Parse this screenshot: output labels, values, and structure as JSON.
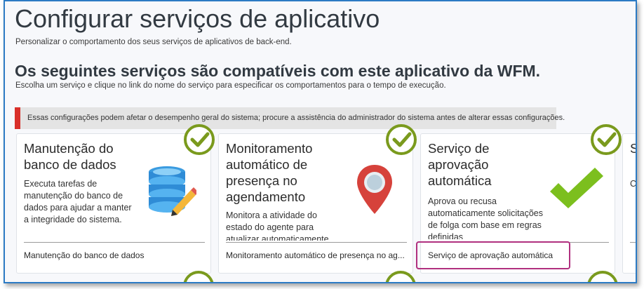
{
  "header": {
    "title": "Configurar serviços de aplicativo",
    "subtitle": "Personalizar o comportamento dos seus serviços de aplicativos de back-end."
  },
  "section": {
    "title": "Os seguintes serviços são compatíveis com este aplicativo da WFM.",
    "subtitle": "Escolha um serviço e clique no link do nome do serviço para especificar os comportamentos para o tempo de execução."
  },
  "warning": {
    "text": "Essas configurações podem afetar o desempenho geral do sistema; procure a assistência do administrador do sistema antes de alterar essas configurações.",
    "accent_color": "#d9302a"
  },
  "colors": {
    "check_green": "#7a9a1d",
    "highlight": "#b0307f",
    "frame_border": "#2c7bc4"
  },
  "cards": [
    {
      "title": "Manutenção do banco de dados",
      "description": "Executa tarefas de manutenção do banco de dados para ajudar a manter a integridade do sistema.",
      "link": "Manutenção do banco de dados",
      "icon": "database-icon",
      "enabled": true
    },
    {
      "title": "Monitoramento automático de presença no agendamento",
      "description": "Monitora a atividade do estado do agente para atualizar automaticamente",
      "link": "Monitoramento automático de presença no ag...",
      "icon": "map-pin-icon",
      "enabled": true
    },
    {
      "title": "Serviço de aprovação automática",
      "description": "Aprova ou recusa automaticamente solicitações de folga com base em regras definidas",
      "link": "Serviço de aprovação automática",
      "icon": "checkmark-icon",
      "enabled": true
    },
    {
      "title": "S",
      "description": "C",
      "link": "",
      "icon": "",
      "enabled": true
    }
  ]
}
